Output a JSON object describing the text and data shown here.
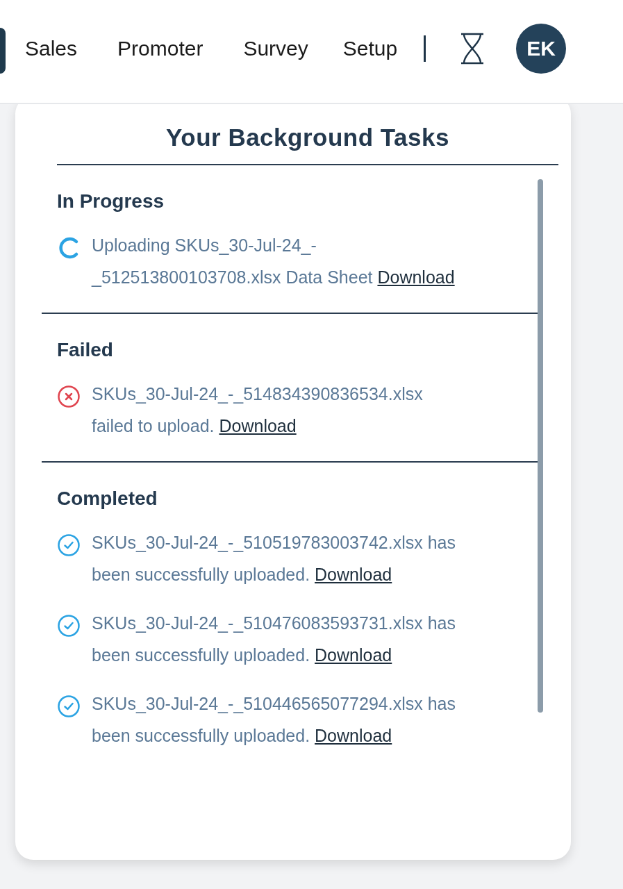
{
  "nav": {
    "items": [
      {
        "label": "Sales"
      },
      {
        "label": "Promoter"
      },
      {
        "label": "Survey"
      },
      {
        "label": "Setup"
      }
    ],
    "avatar": "EK"
  },
  "panel": {
    "title": "Your Background Tasks",
    "sections": [
      {
        "heading": "In Progress",
        "items": [
          {
            "kind": "progress",
            "message_lines": [
              "Uploading SKUs_30-Jul-24_-",
              "_512513800103708.xlsx Data Sheet"
            ],
            "link": "Download"
          }
        ]
      },
      {
        "heading": "Failed",
        "items": [
          {
            "kind": "failed",
            "message_lines": [
              "SKUs_30-Jul-24_-_514834390836534.xlsx",
              "failed to upload."
            ],
            "link": "Download"
          }
        ]
      },
      {
        "heading": "Completed",
        "items": [
          {
            "kind": "completed",
            "message_lines": [
              "SKUs_30-Jul-24_-_510519783003742.xlsx has",
              "been successfully uploaded."
            ],
            "link": "Download"
          },
          {
            "kind": "completed",
            "message_lines": [
              "SKUs_30-Jul-24_-_510476083593731.xlsx has",
              "been successfully uploaded."
            ],
            "link": "Download"
          },
          {
            "kind": "completed",
            "message_lines": [
              "SKUs_30-Jul-24_-_510446565077294.xlsx has",
              "been successfully uploaded."
            ],
            "link": "Download"
          }
        ]
      }
    ]
  }
}
